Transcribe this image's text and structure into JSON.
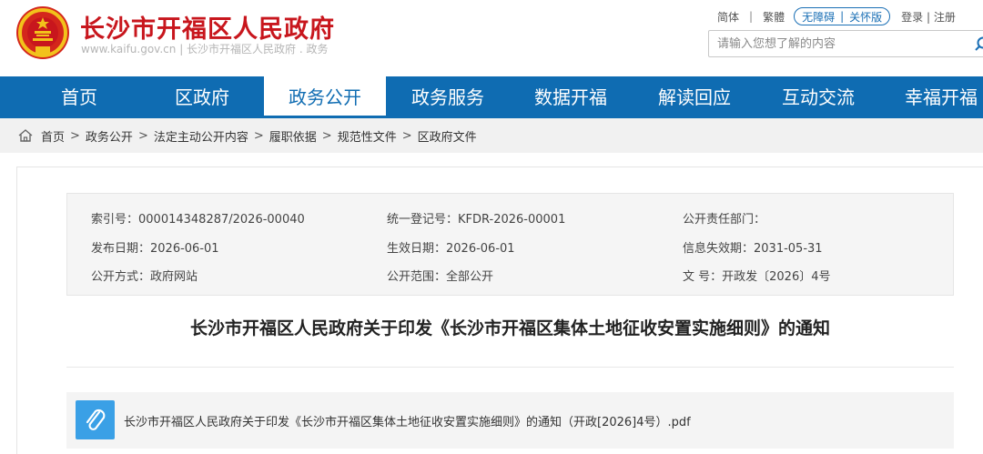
{
  "header": {
    "site_title": "长沙市开福区人民政府",
    "site_subtitle": "www.kaifu.gov.cn | 长沙市开福区人民政府 . 政务",
    "emblem_icon": "national-emblem-icon"
  },
  "top_links": {
    "simplified": "简体",
    "separator": "|",
    "traditional": "繁體",
    "accessible": "无障碍",
    "care_mode": "关怀版",
    "login_register": "登录 | 注册"
  },
  "search": {
    "placeholder": "请输入您想了解的内容",
    "icon": "search-icon"
  },
  "nav": {
    "items": [
      "首页",
      "区政府",
      "政务公开",
      "政务服务",
      "数据开福",
      "解读回应",
      "互动交流",
      "幸福开福"
    ],
    "active_index": 2
  },
  "breadcrumb": {
    "icon": "home-icon",
    "items": [
      "首页",
      "政务公开",
      "法定主动公开内容",
      "履职依据",
      "规范性文件",
      "区政府文件"
    ],
    "separator": ">"
  },
  "meta": {
    "index_no": "索引号：000014348287/2026-00040",
    "reg_no": "统一登记号：KFDR-2026-00001",
    "dept": "公开责任部门：",
    "publish_date": "发布日期：2026-06-01",
    "effective_date": "生效日期：2026-06-01",
    "expiry_date": "信息失效期：2031-05-31",
    "publish_method": "公开方式：政府网站",
    "publish_scope": "公开范围：全部公开",
    "doc_no": "文 号：开政发〔2026〕4号"
  },
  "document": {
    "title": "长沙市开福区人民政府关于印发《长沙市开福区集体土地征收安置实施细则》的通知"
  },
  "attachment": {
    "icon": "paperclip-icon",
    "name": "长沙市开福区人民政府关于印发《长沙市开福区集体土地征收安置实施细则》的通知（开政[2026]4号）.pdf"
  },
  "colors": {
    "brand_red": "#c8161d",
    "nav_blue": "#0f6cb2",
    "attach_blue": "#3aa0e6"
  }
}
